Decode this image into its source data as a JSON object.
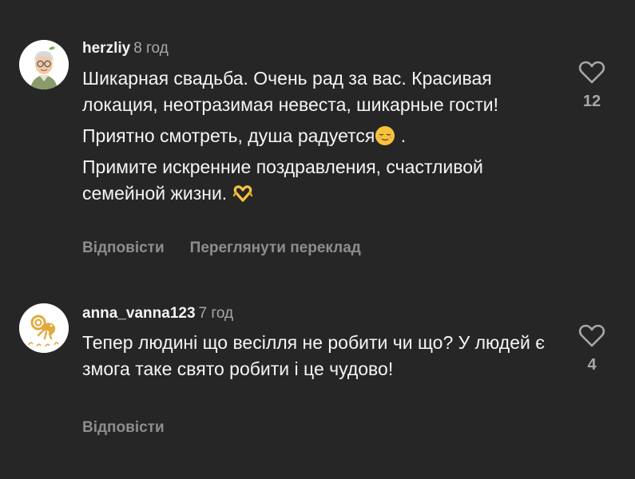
{
  "comments": [
    {
      "username": "herzliy",
      "time": "8 год",
      "paragraphs": [
        "Шикарная свадьба. Очень рад за вас. Красивая локация, неотразимая невеста, шикарные гости!",
        "Приятно смотреть, душа радуется",
        "Примите искренние поздравления, счастливой семейной жизни."
      ],
      "paragraph2_suffix": " .",
      "reply_label": "Відповісти",
      "translate_label": "Переглянути переклад",
      "like_count": "12",
      "emojis": [
        "relieved-face-emoji",
        "heart-hands-emoji"
      ]
    },
    {
      "username": "anna_vanna123",
      "time": "7 год",
      "paragraphs": [
        "Тепер людині що весілля не робити чи що? У людей є змога таке свято робити і це чудово!"
      ],
      "reply_label": "Відповісти",
      "like_count": "4",
      "avatar_icon": "aries-ram-icon"
    }
  ],
  "colors": {
    "background": "#262626",
    "text": "#f5f5f5",
    "muted": "#a8a8a8",
    "action": "#8e8e8e",
    "emoji_yellow": "#f7c23c"
  }
}
